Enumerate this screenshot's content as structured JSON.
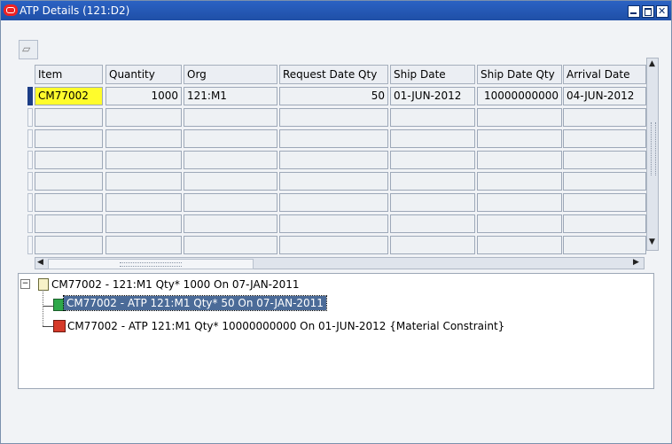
{
  "window": {
    "title": "ATP Details (121:D2)"
  },
  "table": {
    "columns": [
      "Item",
      "Quantity",
      "Org",
      "Request Date Qty",
      "Ship Date",
      "Ship Date Qty",
      "Arrival Date"
    ],
    "rows": [
      [
        "CM77002",
        "1000",
        "121:M1",
        "50",
        "01-JUN-2012",
        "10000000000",
        "04-JUN-2012"
      ]
    ]
  },
  "tree": {
    "root": "CM77002 -  121:M1  Qty* 1000 On 07-JAN-2011",
    "children": [
      "CM77002 - ATP 121:M1  Qty* 50 On 07-JAN-2011",
      "CM77002 - ATP 121:M1  Qty* 10000000000 On 01-JUN-2012 {Material Constraint}"
    ]
  },
  "colors": {
    "titlebar": "#2b62c4",
    "highlight": "#fffc2c",
    "selection": "#4b6b98"
  }
}
